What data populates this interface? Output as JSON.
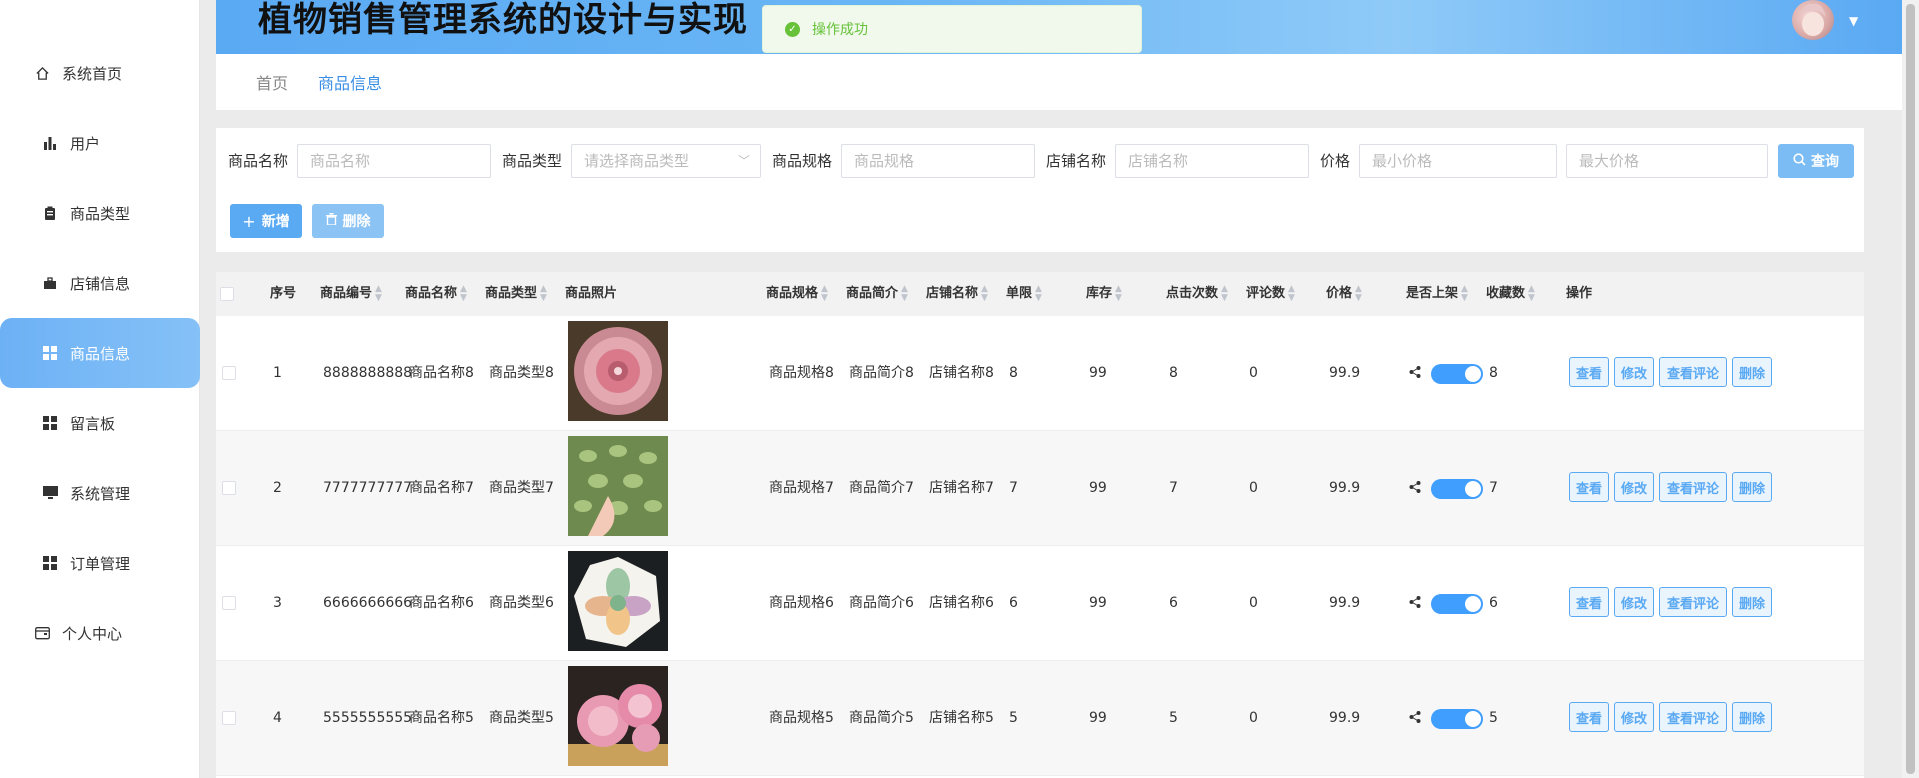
{
  "app": {
    "title": "植物销售管理系统的设计与实现"
  },
  "toast": {
    "text": "操作成功"
  },
  "sidebar": {
    "items": [
      {
        "label": "系统首页",
        "icon": "home-icon"
      },
      {
        "label": "用户",
        "icon": "bar-chart-icon"
      },
      {
        "label": "商品类型",
        "icon": "clipboard-icon"
      },
      {
        "label": "店铺信息",
        "icon": "briefcase-icon"
      },
      {
        "label": "商品信息",
        "icon": "grid-icon",
        "active": true
      },
      {
        "label": "留言板",
        "icon": "grid-icon"
      },
      {
        "label": "系统管理",
        "icon": "monitor-icon"
      },
      {
        "label": "订单管理",
        "icon": "grid-icon"
      },
      {
        "label": "个人中心",
        "icon": "wallet-icon"
      }
    ]
  },
  "breadcrumb": [
    "首页",
    "商品信息"
  ],
  "search": {
    "fields": [
      {
        "label": "商品名称",
        "placeholder": "商品名称"
      },
      {
        "label": "商品类型",
        "placeholder": "请选择商品类型"
      },
      {
        "label": "商品规格",
        "placeholder": "商品规格"
      },
      {
        "label": "店铺名称",
        "placeholder": "店铺名称"
      },
      {
        "label": "价格",
        "placeholder": "最小价格"
      },
      {
        "label": "",
        "placeholder": "最大价格"
      }
    ],
    "query_label": "查询"
  },
  "toolbar": {
    "add_label": "新增",
    "delete_label": "删除"
  },
  "table": {
    "columns": [
      "序号",
      "商品编号",
      "商品名称",
      "商品类型",
      "商品照片",
      "商品规格",
      "商品简介",
      "店铺名称",
      "单限",
      "库存",
      "点击次数",
      "评论数",
      "价格",
      "是否上架",
      "收藏数",
      "操作"
    ],
    "actions": [
      "查看",
      "修改",
      "查看评论",
      "删除"
    ],
    "rows": [
      {
        "idx": "1",
        "code": "8888888888",
        "name": "商品名称8",
        "type": "商品类型8",
        "spec": "商品规格8",
        "intro": "商品简介8",
        "shop": "店铺名称8",
        "limit": "8",
        "stock": "99",
        "clicks": "8",
        "comments": "0",
        "price": "99.9",
        "on_shelf": true,
        "favs": "8"
      },
      {
        "idx": "2",
        "code": "7777777777",
        "name": "商品名称7",
        "type": "商品类型7",
        "spec": "商品规格7",
        "intro": "商品简介7",
        "shop": "店铺名称7",
        "limit": "7",
        "stock": "99",
        "clicks": "7",
        "comments": "0",
        "price": "99.9",
        "on_shelf": true,
        "favs": "7"
      },
      {
        "idx": "3",
        "code": "6666666666",
        "name": "商品名称6",
        "type": "商品类型6",
        "spec": "商品规格6",
        "intro": "商品简介6",
        "shop": "店铺名称6",
        "limit": "6",
        "stock": "99",
        "clicks": "6",
        "comments": "0",
        "price": "99.9",
        "on_shelf": true,
        "favs": "6"
      },
      {
        "idx": "4",
        "code": "5555555555",
        "name": "商品名称5",
        "type": "商品类型5",
        "spec": "商品规格5",
        "intro": "商品简介5",
        "shop": "店铺名称5",
        "limit": "5",
        "stock": "99",
        "clicks": "5",
        "comments": "0",
        "price": "99.9",
        "on_shelf": true,
        "favs": "5"
      }
    ]
  }
}
